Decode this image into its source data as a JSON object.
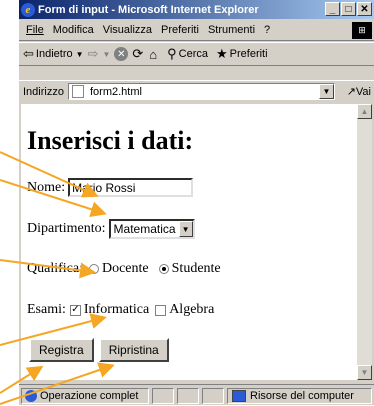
{
  "window": {
    "title": "Form di input - Microsoft Internet Explorer"
  },
  "menu": [
    "File",
    "Modifica",
    "Visualizza",
    "Preferiti",
    "Strumenti",
    "?"
  ],
  "toolbar": {
    "back": "Indietro",
    "search": "Cerca",
    "favorites": "Preferiti"
  },
  "address": {
    "label": "Indirizzo",
    "value": "form2.html",
    "go": "Vai"
  },
  "page": {
    "heading": "Inserisci i dati:",
    "name_label": "Nome:",
    "name_value": "Mario Rossi",
    "dept_label": "Dipartimento:",
    "dept_value": "Matematica",
    "role_label": "Qualifica:",
    "role_options": [
      "Docente",
      "Studente"
    ],
    "role_selected": "Studente",
    "exams_label": "Esami:",
    "exam_options": [
      "Informatica",
      "Algebra"
    ],
    "exam_checked": [
      "Informatica"
    ],
    "submit_label": "Registra",
    "reset_label": "Ripristina"
  },
  "status": {
    "text": "Operazione complet",
    "zone": "Risorse del computer"
  },
  "colors": {
    "arrow": "#f5a623",
    "titlebar": "#0a246a"
  }
}
